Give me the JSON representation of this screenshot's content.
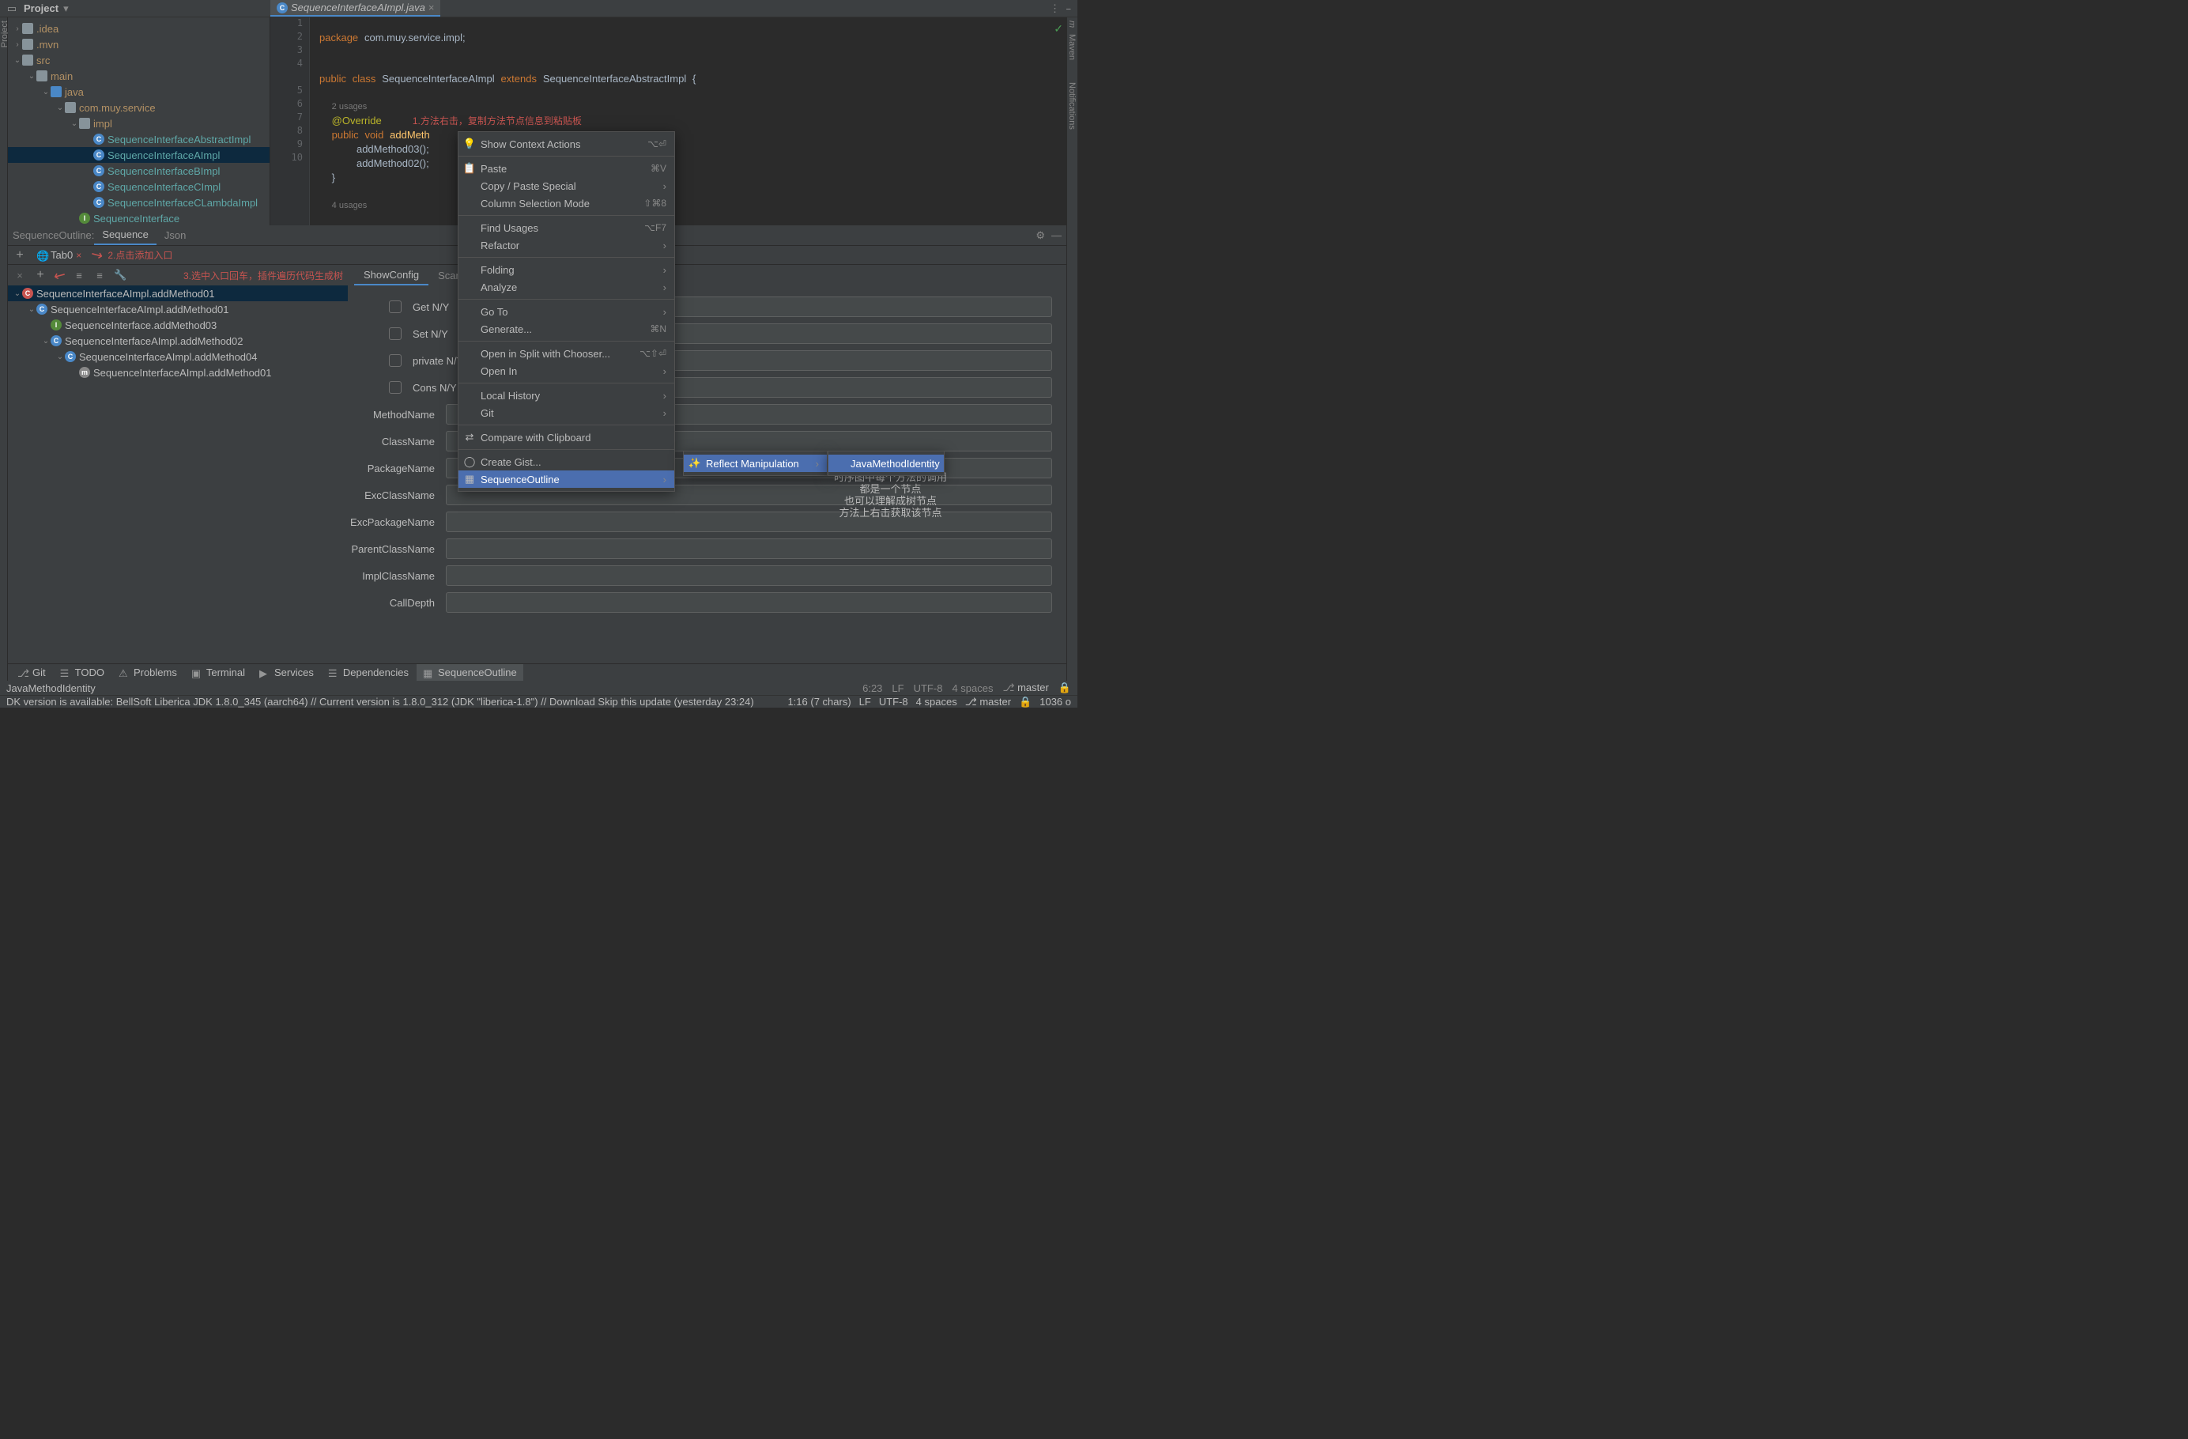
{
  "header": {
    "project_label": "Project"
  },
  "project_tree": [
    {
      "indent": 0,
      "exp": "›",
      "icon": "folder",
      "label": ".idea",
      "cls": "tree-label"
    },
    {
      "indent": 0,
      "exp": "›",
      "icon": "folder",
      "label": ".mvn",
      "cls": "tree-label"
    },
    {
      "indent": 0,
      "exp": "⌄",
      "icon": "folder",
      "label": "src",
      "cls": "tree-label"
    },
    {
      "indent": 1,
      "exp": "⌄",
      "icon": "folder",
      "label": "main",
      "cls": "tree-label"
    },
    {
      "indent": 2,
      "exp": "⌄",
      "icon": "folder-blue",
      "label": "java",
      "cls": "tree-label"
    },
    {
      "indent": 3,
      "exp": "⌄",
      "icon": "folder",
      "label": "com.muy.service",
      "cls": "tree-label"
    },
    {
      "indent": 4,
      "exp": "⌄",
      "icon": "folder",
      "label": "impl",
      "cls": "tree-label"
    },
    {
      "indent": 5,
      "exp": "",
      "icon": "class",
      "label": "SequenceInterfaceAbstractImpl",
      "cls": "tree-label teal"
    },
    {
      "indent": 5,
      "exp": "",
      "icon": "class",
      "label": "SequenceInterfaceAImpl",
      "cls": "tree-label teal",
      "selected": true
    },
    {
      "indent": 5,
      "exp": "",
      "icon": "class",
      "label": "SequenceInterfaceBImpl",
      "cls": "tree-label teal"
    },
    {
      "indent": 5,
      "exp": "",
      "icon": "class",
      "label": "SequenceInterfaceCImpl",
      "cls": "tree-label teal"
    },
    {
      "indent": 5,
      "exp": "",
      "icon": "class",
      "label": "SequenceInterfaceCLambdaImpl",
      "cls": "tree-label teal"
    },
    {
      "indent": 4,
      "exp": "",
      "icon": "interface",
      "label": "SequenceInterface",
      "cls": "tree-label teal"
    }
  ],
  "editor": {
    "tab_name": "SequenceInterfaceAImpl.java",
    "line_numbers": [
      "1",
      "2",
      "3",
      "4",
      "",
      "5",
      "6",
      "7",
      "8",
      "9",
      "10",
      ""
    ],
    "annotation1": "1.方法右击，复制方法节点信息到粘贴板",
    "usages1": "2 usages",
    "usages2": "4 usages",
    "code_package": "package",
    "code_pkg_val": "com.muy.service.impl",
    "code_public": "public",
    "code_class": "class",
    "code_cls_name": "SequenceInterfaceAImpl",
    "code_extends": "extends",
    "code_parent": "SequenceInterfaceAbstractImpl",
    "code_override": "@Override",
    "code_void": "void",
    "code_method": "addMeth",
    "code_call1": "addMethod03();",
    "code_call2": "addMethod02();"
  },
  "mid_tabs": {
    "label": "SequenceOutline:",
    "t1": "Sequence",
    "t2": "Json"
  },
  "sub_tab": {
    "name": "Tab0",
    "annot": "2.点击添加入口"
  },
  "tool_annot": "3.选中入口回车，插件遍历代码生成树",
  "seq_tree": [
    {
      "indent": 0,
      "exp": "⌄",
      "icon": "m-red",
      "label": "SequenceInterfaceAImpl.addMethod01",
      "selected": true
    },
    {
      "indent": 1,
      "exp": "⌄",
      "icon": "m-blue",
      "label": "SequenceInterfaceAImpl.addMethod01"
    },
    {
      "indent": 2,
      "exp": "",
      "icon": "m-green",
      "label": "SequenceInterface.addMethod03"
    },
    {
      "indent": 2,
      "exp": "⌄",
      "icon": "m-blue",
      "label": "SequenceInterfaceAImpl.addMethod02"
    },
    {
      "indent": 3,
      "exp": "⌄",
      "icon": "m-blue",
      "label": "SequenceInterfaceAImpl.addMethod04"
    },
    {
      "indent": 4,
      "exp": "",
      "icon": "m-gray",
      "label": "SequenceInterfaceAImpl.addMethod01"
    }
  ],
  "form": {
    "tabs": [
      "ShowConfig",
      "ScanC"
    ],
    "rows": [
      {
        "label": "Get N/Y",
        "check": true
      },
      {
        "label": "Set N/Y",
        "check": true
      },
      {
        "label": "private N/Y",
        "check": true
      },
      {
        "label": "Cons N/Y",
        "check": true
      },
      {
        "label": "MethodName",
        "check": false
      },
      {
        "label": "ClassName",
        "check": false
      },
      {
        "label": "PackageName",
        "check": false
      },
      {
        "label": "ExcClassName",
        "check": false
      },
      {
        "label": "ExcPackageName",
        "check": false
      },
      {
        "label": "ParentClassName",
        "check": false
      },
      {
        "label": "ImplClassName",
        "check": false
      },
      {
        "label": "CallDepth",
        "check": false
      }
    ]
  },
  "ctx_menu": [
    {
      "type": "item",
      "label": "Show Context Actions",
      "sc": "⌥⏎",
      "icon": "bulb"
    },
    {
      "type": "sep"
    },
    {
      "type": "item",
      "label": "Paste",
      "sc": "⌘V",
      "icon": "paste"
    },
    {
      "type": "item",
      "label": "Copy / Paste Special",
      "sub": true
    },
    {
      "type": "item",
      "label": "Column Selection Mode",
      "sc": "⇧⌘8"
    },
    {
      "type": "sep"
    },
    {
      "type": "item",
      "label": "Find Usages",
      "sc": "⌥F7"
    },
    {
      "type": "item",
      "label": "Refactor",
      "sub": true
    },
    {
      "type": "sep"
    },
    {
      "type": "item",
      "label": "Folding",
      "sub": true
    },
    {
      "type": "item",
      "label": "Analyze",
      "sub": true
    },
    {
      "type": "sep"
    },
    {
      "type": "item",
      "label": "Go To",
      "sub": true
    },
    {
      "type": "item",
      "label": "Generate...",
      "sc": "⌘N"
    },
    {
      "type": "sep"
    },
    {
      "type": "item",
      "label": "Open in Split with Chooser...",
      "sc": "⌥⇧⏎"
    },
    {
      "type": "item",
      "label": "Open In",
      "sub": true
    },
    {
      "type": "sep"
    },
    {
      "type": "item",
      "label": "Local History",
      "sub": true
    },
    {
      "type": "item",
      "label": "Git",
      "sub": true
    },
    {
      "type": "sep"
    },
    {
      "type": "item",
      "label": "Compare with Clipboard",
      "icon": "diff"
    },
    {
      "type": "sep"
    },
    {
      "type": "item",
      "label": "Create Gist...",
      "icon": "github"
    },
    {
      "type": "item",
      "label": "SequenceOutline",
      "sub": true,
      "highlighted": true,
      "icon": "seq"
    }
  ],
  "submenu": [
    {
      "label": "Reflect Manipulation",
      "sub": true,
      "highlighted": true,
      "icon": "wand"
    }
  ],
  "submenu2": [
    {
      "label": "JavaMethodIdentity",
      "highlighted": true
    }
  ],
  "red_notes": [
    "时序图中每个方法的调用",
    "都是一个节点",
    "也可以理解成树节点",
    "方法上右击获取该节点"
  ],
  "toolwin": [
    {
      "label": "Git",
      "icon": "git"
    },
    {
      "label": "TODO",
      "icon": "todo"
    },
    {
      "label": "Problems",
      "icon": "problems"
    },
    {
      "label": "Terminal",
      "icon": "terminal"
    },
    {
      "label": "Services",
      "icon": "services"
    },
    {
      "label": "Dependencies",
      "icon": "deps"
    },
    {
      "label": "SequenceOutline",
      "icon": "seq",
      "active": true
    }
  ],
  "status1": {
    "left": "JavaMethodIdentity",
    "items": [
      "6:23",
      "LF",
      "UTF-8",
      "4 spaces",
      "master"
    ]
  },
  "status2": {
    "left": "DK version is available: BellSoft Liberica JDK 1.8.0_345 (aarch64) // Current version is 1.8.0_312 (JDK \"liberica-1.8\") // Download   Skip this update (yesterday 23:24)",
    "items": [
      "1:16 (7 chars)",
      "LF",
      "UTF-8",
      "4 spaces",
      "master",
      "1036 o"
    ]
  },
  "right_stripe": [
    "m",
    "Maven",
    "Notifications"
  ]
}
